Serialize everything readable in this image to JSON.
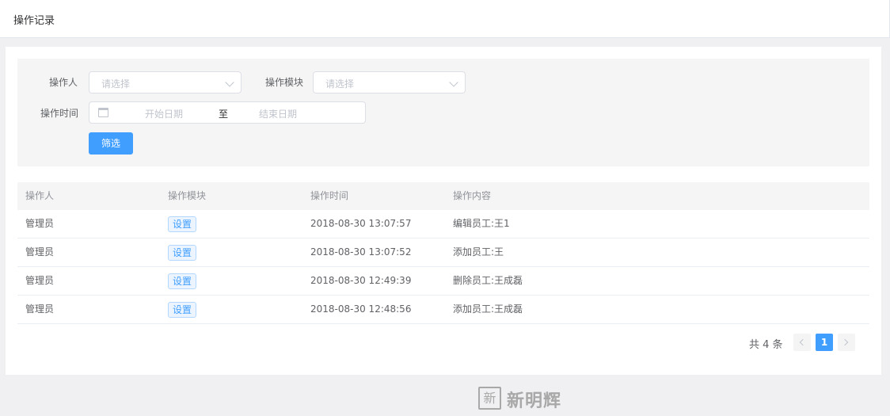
{
  "header": {
    "title": "操作记录"
  },
  "filter": {
    "operator_label": "操作人",
    "operator_placeholder": "请选择",
    "module_label": "操作模块",
    "module_placeholder": "请选择",
    "time_label": "操作时间",
    "start_placeholder": "开始日期",
    "range_separator": "至",
    "end_placeholder": "结束日期",
    "submit_label": "筛选"
  },
  "table": {
    "headers": [
      "操作人",
      "操作模块",
      "操作时间",
      "操作内容"
    ],
    "rows": [
      {
        "operator": "管理员",
        "module": "设置",
        "time": "2018-08-30 13:07:57",
        "content": "编辑员工:王1"
      },
      {
        "operator": "管理员",
        "module": "设置",
        "time": "2018-08-30 13:07:52",
        "content": "添加员工:王"
      },
      {
        "operator": "管理员",
        "module": "设置",
        "time": "2018-08-30 12:49:39",
        "content": "删除员工:王成磊"
      },
      {
        "operator": "管理员",
        "module": "设置",
        "time": "2018-08-30 12:48:56",
        "content": "添加员工:王成磊"
      }
    ]
  },
  "pagination": {
    "total_text": "共 4 条",
    "current_page": "1"
  },
  "watermark": {
    "seal": "新",
    "text": "新明辉"
  },
  "colors": {
    "primary": "#409eff",
    "tag_bg": "#ecf5ff",
    "filter_bg": "#f5f5f5",
    "page_bg": "#f0f0f3"
  },
  "icons": [
    "calendar-icon",
    "chevron-down-icon",
    "chevron-left-icon",
    "chevron-right-icon"
  ]
}
